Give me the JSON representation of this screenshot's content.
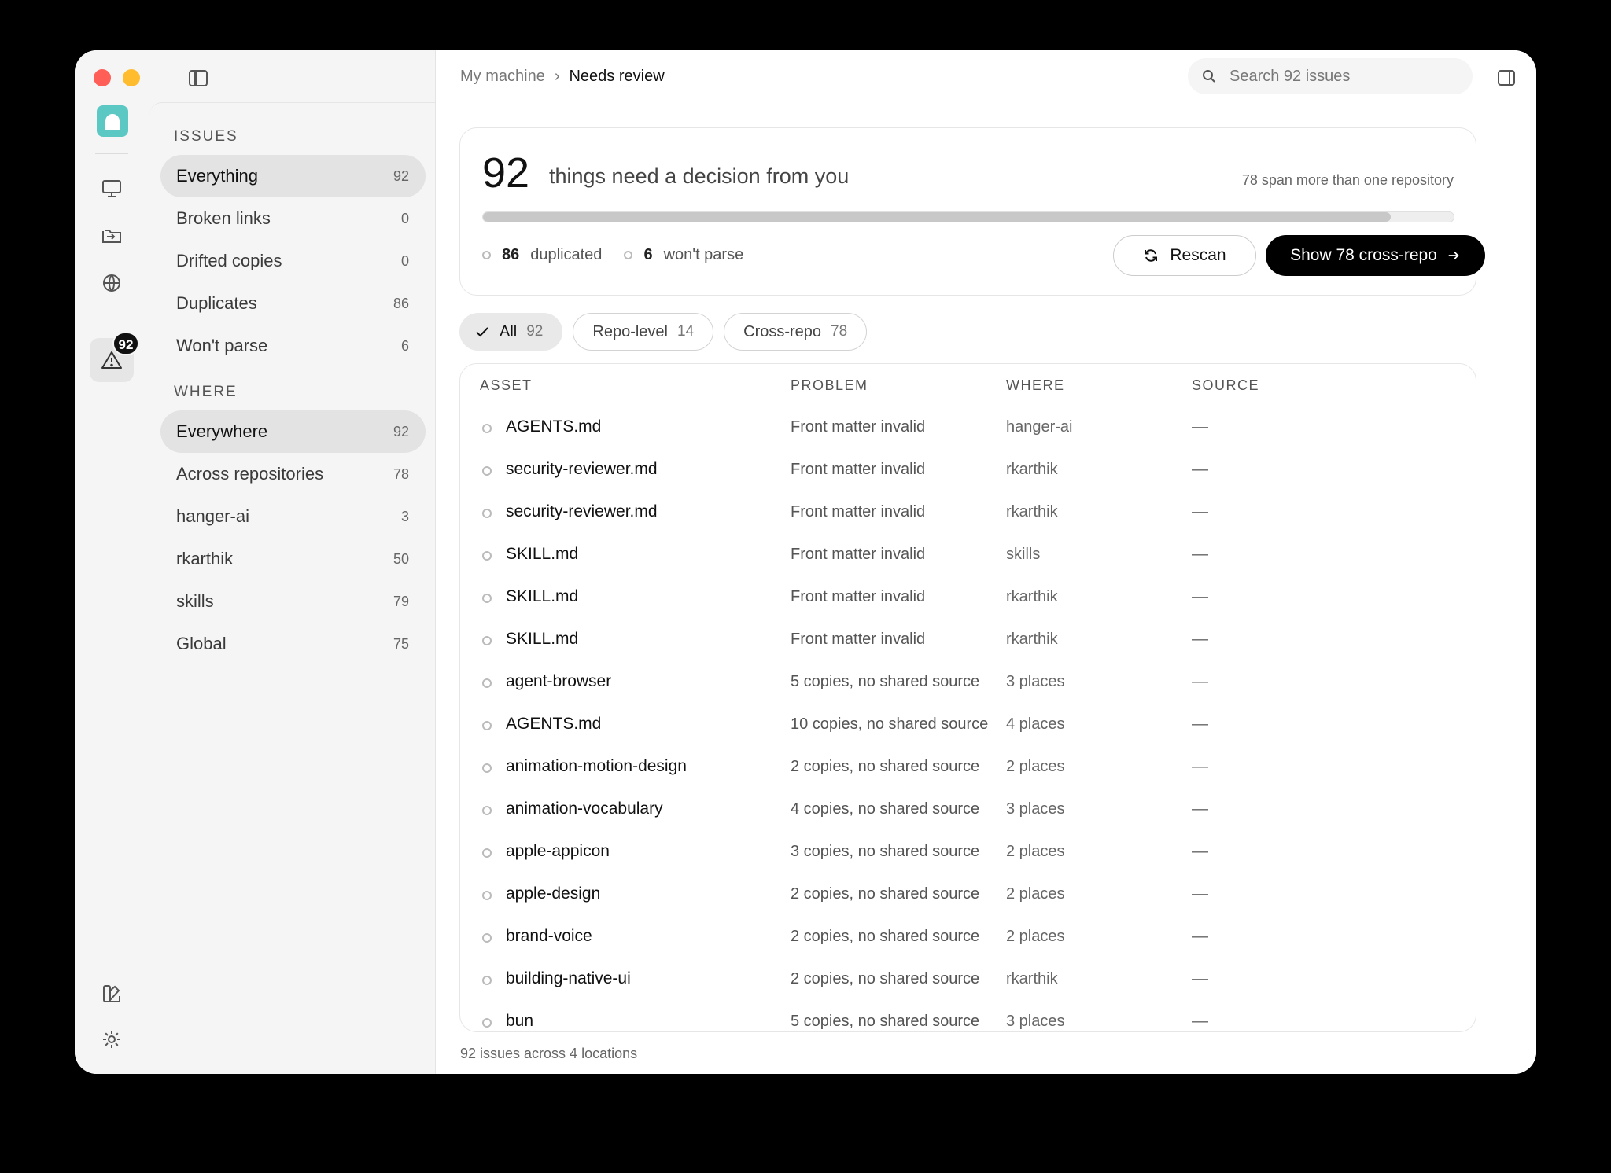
{
  "rail": {
    "badge_count": "92"
  },
  "sidebar": {
    "issues_title": "ISSUES",
    "issues": [
      {
        "label": "Everything",
        "count": "92"
      },
      {
        "label": "Broken links",
        "count": "0"
      },
      {
        "label": "Drifted copies",
        "count": "0"
      },
      {
        "label": "Duplicates",
        "count": "86"
      },
      {
        "label": "Won't parse",
        "count": "6"
      }
    ],
    "where_title": "WHERE",
    "where": [
      {
        "label": "Everywhere",
        "count": "92"
      },
      {
        "label": "Across repositories",
        "count": "78"
      },
      {
        "label": "hanger-ai",
        "count": "3"
      },
      {
        "label": "rkarthik",
        "count": "50"
      },
      {
        "label": "skills",
        "count": "79"
      },
      {
        "label": "Global",
        "count": "75"
      }
    ]
  },
  "header": {
    "breadcrumb_root": "My machine",
    "breadcrumb_sep": "›",
    "breadcrumb_current": "Needs review",
    "search_placeholder": "Search 92 issues"
  },
  "summary": {
    "count": "92",
    "text": "things need a decision from you",
    "span_note": "78 span more than one repository",
    "progress_fraction": 0.935,
    "duplicated_count": "86",
    "duplicated_label": "duplicated",
    "wont_parse_count": "6",
    "wont_parse_label": "won't parse",
    "rescan_label": "Rescan",
    "show_label": "Show 78 cross-repo"
  },
  "chips": [
    {
      "label": "All",
      "count": "92"
    },
    {
      "label": "Repo-level",
      "count": "14"
    },
    {
      "label": "Cross-repo",
      "count": "78"
    }
  ],
  "table": {
    "headers": {
      "asset": "ASSET",
      "problem": "PROBLEM",
      "where": "WHERE",
      "source": "SOURCE"
    },
    "rows": [
      {
        "asset": "AGENTS.md",
        "problem": "Front matter invalid",
        "where": "hanger-ai",
        "source": "—"
      },
      {
        "asset": "security-reviewer.md",
        "problem": "Front matter invalid",
        "where": "rkarthik",
        "source": "—"
      },
      {
        "asset": "security-reviewer.md",
        "problem": "Front matter invalid",
        "where": "rkarthik",
        "source": "—"
      },
      {
        "asset": "SKILL.md",
        "problem": "Front matter invalid",
        "where": "skills",
        "source": "—"
      },
      {
        "asset": "SKILL.md",
        "problem": "Front matter invalid",
        "where": "rkarthik",
        "source": "—"
      },
      {
        "asset": "SKILL.md",
        "problem": "Front matter invalid",
        "where": "rkarthik",
        "source": "—"
      },
      {
        "asset": "agent-browser",
        "problem": "5 copies, no shared source",
        "where": "3 places",
        "source": "—"
      },
      {
        "asset": "AGENTS.md",
        "problem": "10 copies, no shared source",
        "where": "4 places",
        "source": "—"
      },
      {
        "asset": "animation-motion-design",
        "problem": "2 copies, no shared source",
        "where": "2 places",
        "source": "—"
      },
      {
        "asset": "animation-vocabulary",
        "problem": "4 copies, no shared source",
        "where": "3 places",
        "source": "—"
      },
      {
        "asset": "apple-appicon",
        "problem": "3 copies, no shared source",
        "where": "2 places",
        "source": "—"
      },
      {
        "asset": "apple-design",
        "problem": "2 copies, no shared source",
        "where": "2 places",
        "source": "—"
      },
      {
        "asset": "brand-voice",
        "problem": "2 copies, no shared source",
        "where": "2 places",
        "source": "—"
      },
      {
        "asset": "building-native-ui",
        "problem": "2 copies, no shared source",
        "where": "rkarthik",
        "source": "—"
      },
      {
        "asset": "bun",
        "problem": "5 copies, no shared source",
        "where": "3 places",
        "source": "—"
      }
    ]
  },
  "footer": {
    "text": "92 issues across 4 locations"
  },
  "colors": {
    "accent": "#5cc8c4",
    "primary_button": "#000000",
    "selection": "#e3e3e3"
  }
}
